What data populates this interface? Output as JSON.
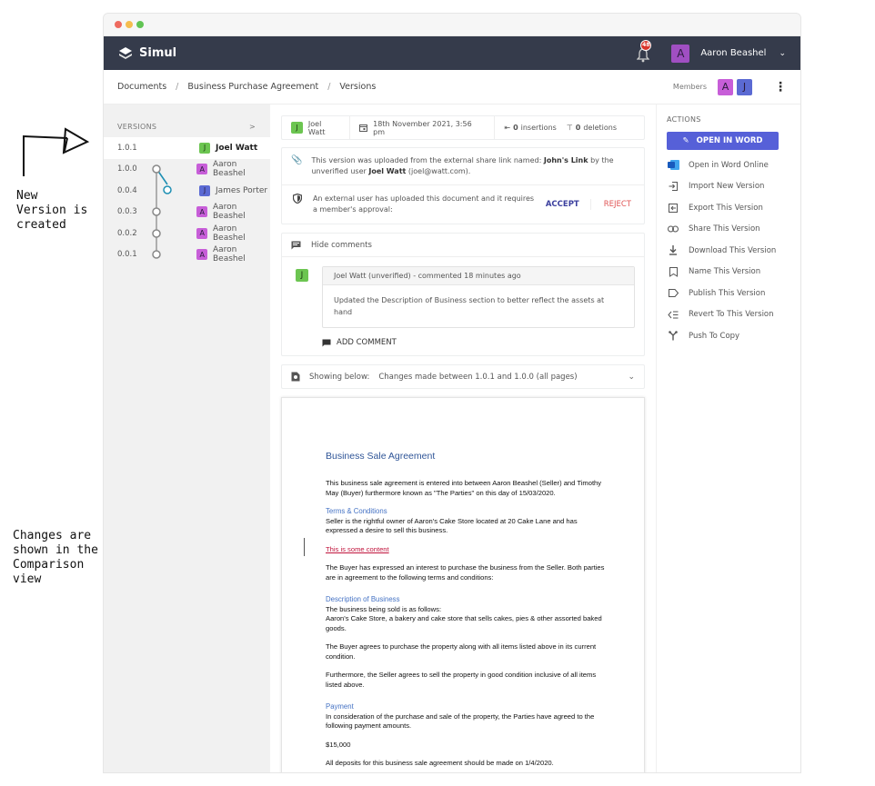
{
  "annotations": {
    "top_note": "New\nVersion is\ncreated",
    "bottom_note": "Changes are\nshown in the\nComparison\nview"
  },
  "window": {
    "traffic_lights": [
      "#ee6a5f",
      "#f5bd4f",
      "#61c454"
    ]
  },
  "appbar": {
    "brand": "Simul",
    "notification_count": "48",
    "user_initial": "A",
    "user_name": "Aaron Beashel",
    "colors": {
      "bar": "#353b4b",
      "badge": "#d9342b"
    }
  },
  "breadcrumb": {
    "items": [
      "Documents",
      "Business Purchase Agreement",
      "Versions"
    ],
    "separator": "/",
    "members_label": "Members",
    "members": [
      {
        "initial": "A",
        "color": "#c75ed8"
      },
      {
        "initial": "J",
        "color": "#5b6ad3"
      }
    ]
  },
  "sidebar": {
    "title": "VERSIONS",
    "expand_glyph": ">",
    "versions": [
      {
        "number": "1.0.1",
        "initial": "J",
        "author": "Joel Watt",
        "color": "#6cc551",
        "active": true
      },
      {
        "number": "1.0.0",
        "initial": "A",
        "author": "Aaron Beashel",
        "color": "#c75ed8"
      },
      {
        "number": "0.0.4",
        "initial": "J",
        "author": "James Porter",
        "color": "#5b6ad3"
      },
      {
        "number": "0.0.3",
        "initial": "A",
        "author": "Aaron Beashel",
        "color": "#c75ed8"
      },
      {
        "number": "0.0.2",
        "initial": "A",
        "author": "Aaron Beashel",
        "color": "#c75ed8"
      },
      {
        "number": "0.0.1",
        "initial": "A",
        "author": "Aaron Beashel",
        "color": "#c75ed8"
      }
    ]
  },
  "version_meta": {
    "author_initial": "J",
    "author": "Joel Watt",
    "date": "18th November 2021, 3:56 pm",
    "insertions_count": "0",
    "insertions_label": "insertions",
    "deletions_count": "0",
    "deletions_label": "deletions"
  },
  "upload_info": {
    "text_prefix": "This version was uploaded from the external share link named: ",
    "link_name": "John's Link",
    "text_mid": " by the unverified user ",
    "user": "Joel Watt",
    "email": " (joel@watt.com)."
  },
  "approval": {
    "text": "An external user has uploaded this document and it requires a member's approval:",
    "accept_label": "ACCEPT",
    "reject_label": "REJECT"
  },
  "comments": {
    "toggle_label": "Hide comments",
    "items": [
      {
        "initial": "J",
        "header": "Joel Watt (unverified) - commented 18 minutes ago",
        "text": "Updated the Description of Business section to better reflect the assets at hand"
      }
    ],
    "add_label": "ADD COMMENT"
  },
  "showing": {
    "label": "Showing below:",
    "value": "Changes made between 1.0.1 and 1.0.0 (all pages)"
  },
  "document": {
    "title": "Business Sale Agreement",
    "intro": "This business sale agreement is entered into between Aaron Beashel (Seller) and Timothy May (Buyer) furthermore known as \"The Parties\"  on this day of 15/03/2020.",
    "terms_heading": "Terms & Conditions",
    "terms_text": "Seller is the rightful owner of Aaron's Cake Store located at 20 Cake Lane and has expressed a desire to sell this business.",
    "inserted_text": "This is some content",
    "buyer_text": "The Buyer has expressed an interest to purchase the business from the Seller. Both parties are in agreement to the following terms and conditions:",
    "desc_heading": "Description of Business",
    "desc_line1": "The business being sold is as follows:",
    "desc_line2": "Aaron's Cake Store, a bakery and cake store that sells cakes, pies & other assorted baked goods.",
    "purchase_text": "The Buyer agrees to purchase the property along with all items listed above in its current condition.",
    "furthermore_text": "Furthermore, the Seller agrees to sell the property in good condition inclusive of all items listed above.",
    "payment_heading": "Payment",
    "payment_text": "In consideration of the purchase and sale of the property, the Parties have agreed to the following payment amounts.",
    "amount": "$15,000",
    "deposit_text": "All deposits for this business sale agreement should be made on 1/4/2020."
  },
  "actions": {
    "title": "ACTIONS",
    "primary_label": "OPEN IN WORD",
    "primary_color": "#5660d8",
    "items": [
      {
        "label": "Open in Word Online",
        "icon": "word-icon"
      },
      {
        "label": "Import New Version",
        "icon": "import-icon"
      },
      {
        "label": "Export This Version",
        "icon": "export-icon"
      },
      {
        "label": "Share This Version",
        "icon": "link-icon"
      },
      {
        "label": "Download This Version",
        "icon": "download-icon"
      },
      {
        "label": "Name This Version",
        "icon": "bookmark-icon"
      },
      {
        "label": "Publish This Version",
        "icon": "label-icon"
      },
      {
        "label": "Revert To This Version",
        "icon": "revert-icon"
      },
      {
        "label": "Push To Copy",
        "icon": "fork-icon"
      }
    ]
  }
}
